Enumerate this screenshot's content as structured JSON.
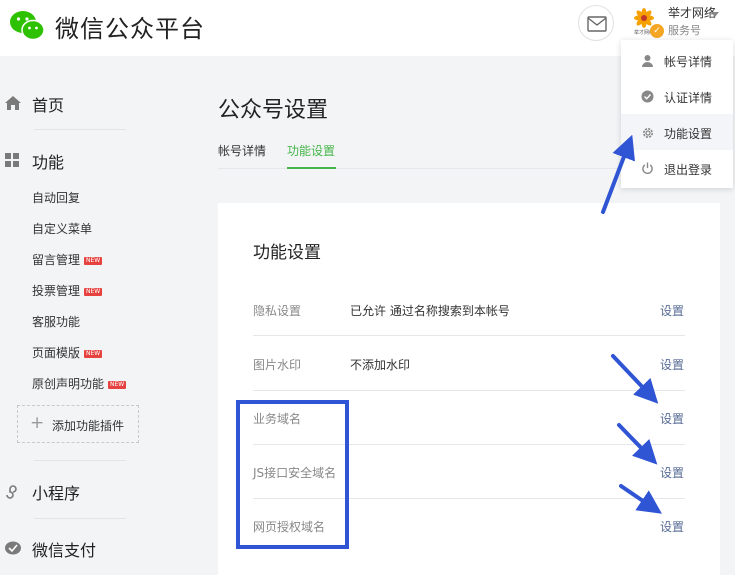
{
  "header": {
    "brand": "微信公众平台",
    "account_name": "举才网络",
    "account_type": "服务号",
    "logo_text": "举才网络"
  },
  "sidebar": {
    "home": "首页",
    "functions": "功能",
    "sub_items": [
      {
        "label": "自动回复",
        "new": false
      },
      {
        "label": "自定义菜单",
        "new": false
      },
      {
        "label": "留言管理",
        "new": true
      },
      {
        "label": "投票管理",
        "new": true
      },
      {
        "label": "客服功能",
        "new": false
      },
      {
        "label": "页面模版",
        "new": true
      },
      {
        "label": "原创声明功能",
        "new": true
      }
    ],
    "new_badge": "NEW",
    "add_plugin": "添加功能插件",
    "mini_program": "小程序",
    "wechat_pay": "微信支付"
  },
  "main": {
    "title": "公众号设置",
    "tabs": [
      "帐号详情",
      "功能设置"
    ],
    "active_tab": "功能设置",
    "card_title": "功能设置",
    "rows": [
      {
        "label": "隐私设置",
        "value": "已允许 通过名称搜索到本帐号",
        "action": "设置"
      },
      {
        "label": "图片水印",
        "value": "不添加水印",
        "action": "设置"
      },
      {
        "label": "业务域名",
        "value": "",
        "action": "设置"
      },
      {
        "label": "JS接口安全域名",
        "value": "",
        "action": "设置"
      },
      {
        "label": "网页授权域名",
        "value": "",
        "action": "设置"
      }
    ]
  },
  "dropdown": {
    "items": [
      "帐号详情",
      "认证详情",
      "功能设置",
      "退出登录"
    ],
    "active": "功能设置"
  },
  "colors": {
    "accent_green": "#44b549",
    "link_blue": "#576b95",
    "annotation_blue": "#2f55d4",
    "new_badge_red": "#e64340"
  }
}
